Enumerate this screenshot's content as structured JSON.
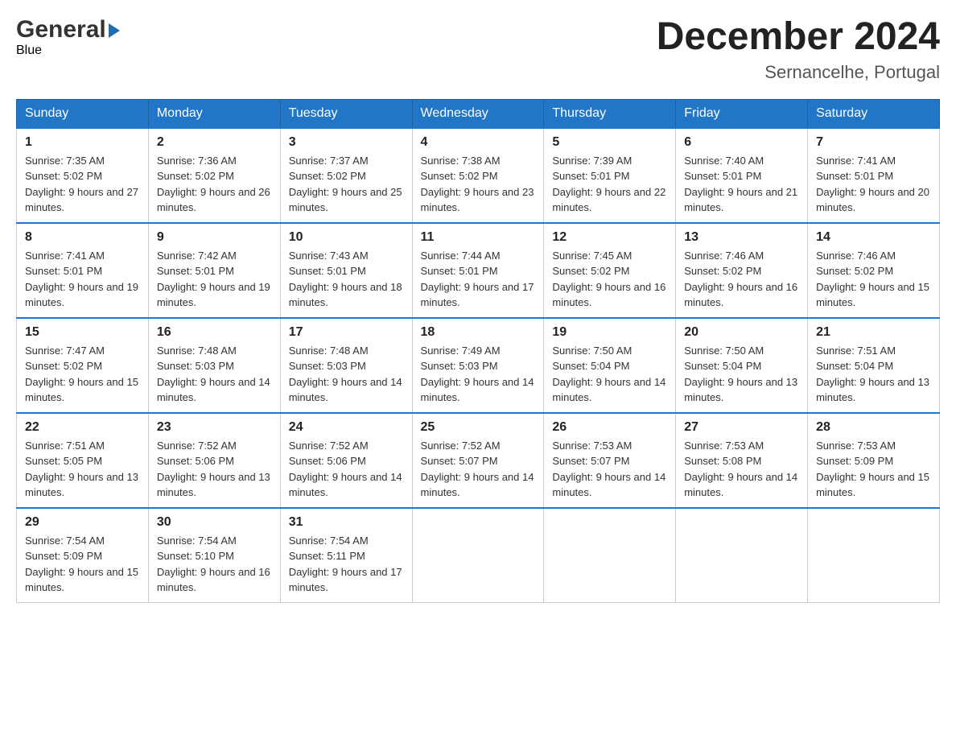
{
  "header": {
    "month_title": "December 2024",
    "location": "Sernancelhe, Portugal"
  },
  "days_of_week": [
    "Sunday",
    "Monday",
    "Tuesday",
    "Wednesday",
    "Thursday",
    "Friday",
    "Saturday"
  ],
  "weeks": [
    [
      {
        "day": "1",
        "sunrise": "Sunrise: 7:35 AM",
        "sunset": "Sunset: 5:02 PM",
        "daylight": "Daylight: 9 hours and 27 minutes."
      },
      {
        "day": "2",
        "sunrise": "Sunrise: 7:36 AM",
        "sunset": "Sunset: 5:02 PM",
        "daylight": "Daylight: 9 hours and 26 minutes."
      },
      {
        "day": "3",
        "sunrise": "Sunrise: 7:37 AM",
        "sunset": "Sunset: 5:02 PM",
        "daylight": "Daylight: 9 hours and 25 minutes."
      },
      {
        "day": "4",
        "sunrise": "Sunrise: 7:38 AM",
        "sunset": "Sunset: 5:02 PM",
        "daylight": "Daylight: 9 hours and 23 minutes."
      },
      {
        "day": "5",
        "sunrise": "Sunrise: 7:39 AM",
        "sunset": "Sunset: 5:01 PM",
        "daylight": "Daylight: 9 hours and 22 minutes."
      },
      {
        "day": "6",
        "sunrise": "Sunrise: 7:40 AM",
        "sunset": "Sunset: 5:01 PM",
        "daylight": "Daylight: 9 hours and 21 minutes."
      },
      {
        "day": "7",
        "sunrise": "Sunrise: 7:41 AM",
        "sunset": "Sunset: 5:01 PM",
        "daylight": "Daylight: 9 hours and 20 minutes."
      }
    ],
    [
      {
        "day": "8",
        "sunrise": "Sunrise: 7:41 AM",
        "sunset": "Sunset: 5:01 PM",
        "daylight": "Daylight: 9 hours and 19 minutes."
      },
      {
        "day": "9",
        "sunrise": "Sunrise: 7:42 AM",
        "sunset": "Sunset: 5:01 PM",
        "daylight": "Daylight: 9 hours and 19 minutes."
      },
      {
        "day": "10",
        "sunrise": "Sunrise: 7:43 AM",
        "sunset": "Sunset: 5:01 PM",
        "daylight": "Daylight: 9 hours and 18 minutes."
      },
      {
        "day": "11",
        "sunrise": "Sunrise: 7:44 AM",
        "sunset": "Sunset: 5:01 PM",
        "daylight": "Daylight: 9 hours and 17 minutes."
      },
      {
        "day": "12",
        "sunrise": "Sunrise: 7:45 AM",
        "sunset": "Sunset: 5:02 PM",
        "daylight": "Daylight: 9 hours and 16 minutes."
      },
      {
        "day": "13",
        "sunrise": "Sunrise: 7:46 AM",
        "sunset": "Sunset: 5:02 PM",
        "daylight": "Daylight: 9 hours and 16 minutes."
      },
      {
        "day": "14",
        "sunrise": "Sunrise: 7:46 AM",
        "sunset": "Sunset: 5:02 PM",
        "daylight": "Daylight: 9 hours and 15 minutes."
      }
    ],
    [
      {
        "day": "15",
        "sunrise": "Sunrise: 7:47 AM",
        "sunset": "Sunset: 5:02 PM",
        "daylight": "Daylight: 9 hours and 15 minutes."
      },
      {
        "day": "16",
        "sunrise": "Sunrise: 7:48 AM",
        "sunset": "Sunset: 5:03 PM",
        "daylight": "Daylight: 9 hours and 14 minutes."
      },
      {
        "day": "17",
        "sunrise": "Sunrise: 7:48 AM",
        "sunset": "Sunset: 5:03 PM",
        "daylight": "Daylight: 9 hours and 14 minutes."
      },
      {
        "day": "18",
        "sunrise": "Sunrise: 7:49 AM",
        "sunset": "Sunset: 5:03 PM",
        "daylight": "Daylight: 9 hours and 14 minutes."
      },
      {
        "day": "19",
        "sunrise": "Sunrise: 7:50 AM",
        "sunset": "Sunset: 5:04 PM",
        "daylight": "Daylight: 9 hours and 14 minutes."
      },
      {
        "day": "20",
        "sunrise": "Sunrise: 7:50 AM",
        "sunset": "Sunset: 5:04 PM",
        "daylight": "Daylight: 9 hours and 13 minutes."
      },
      {
        "day": "21",
        "sunrise": "Sunrise: 7:51 AM",
        "sunset": "Sunset: 5:04 PM",
        "daylight": "Daylight: 9 hours and 13 minutes."
      }
    ],
    [
      {
        "day": "22",
        "sunrise": "Sunrise: 7:51 AM",
        "sunset": "Sunset: 5:05 PM",
        "daylight": "Daylight: 9 hours and 13 minutes."
      },
      {
        "day": "23",
        "sunrise": "Sunrise: 7:52 AM",
        "sunset": "Sunset: 5:06 PM",
        "daylight": "Daylight: 9 hours and 13 minutes."
      },
      {
        "day": "24",
        "sunrise": "Sunrise: 7:52 AM",
        "sunset": "Sunset: 5:06 PM",
        "daylight": "Daylight: 9 hours and 14 minutes."
      },
      {
        "day": "25",
        "sunrise": "Sunrise: 7:52 AM",
        "sunset": "Sunset: 5:07 PM",
        "daylight": "Daylight: 9 hours and 14 minutes."
      },
      {
        "day": "26",
        "sunrise": "Sunrise: 7:53 AM",
        "sunset": "Sunset: 5:07 PM",
        "daylight": "Daylight: 9 hours and 14 minutes."
      },
      {
        "day": "27",
        "sunrise": "Sunrise: 7:53 AM",
        "sunset": "Sunset: 5:08 PM",
        "daylight": "Daylight: 9 hours and 14 minutes."
      },
      {
        "day": "28",
        "sunrise": "Sunrise: 7:53 AM",
        "sunset": "Sunset: 5:09 PM",
        "daylight": "Daylight: 9 hours and 15 minutes."
      }
    ],
    [
      {
        "day": "29",
        "sunrise": "Sunrise: 7:54 AM",
        "sunset": "Sunset: 5:09 PM",
        "daylight": "Daylight: 9 hours and 15 minutes."
      },
      {
        "day": "30",
        "sunrise": "Sunrise: 7:54 AM",
        "sunset": "Sunset: 5:10 PM",
        "daylight": "Daylight: 9 hours and 16 minutes."
      },
      {
        "day": "31",
        "sunrise": "Sunrise: 7:54 AM",
        "sunset": "Sunset: 5:11 PM",
        "daylight": "Daylight: 9 hours and 17 minutes."
      },
      null,
      null,
      null,
      null
    ]
  ]
}
